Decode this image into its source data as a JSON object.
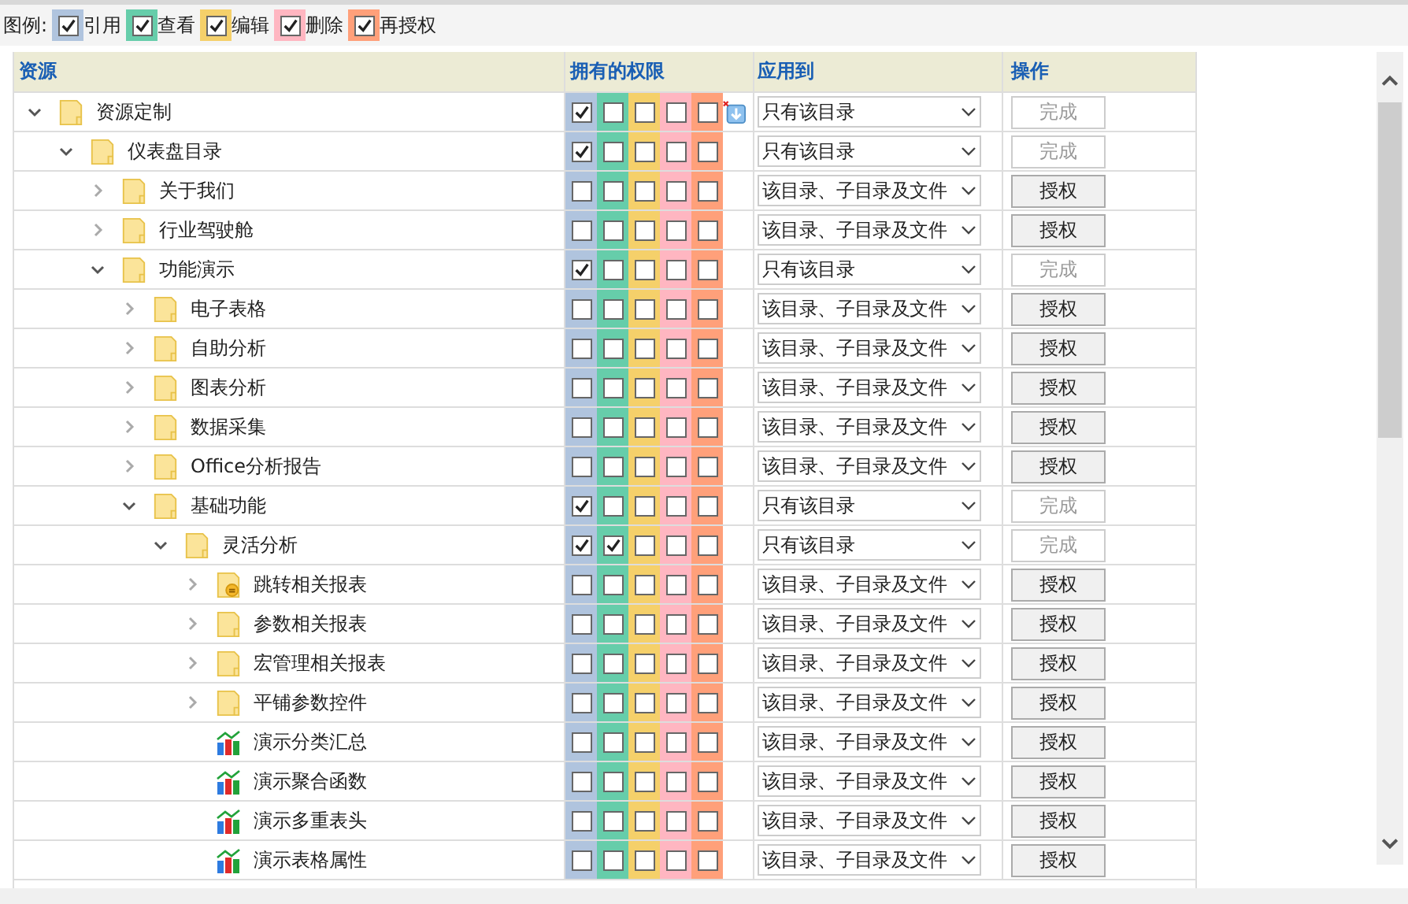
{
  "legend": {
    "title": "图例:",
    "items": [
      {
        "label": "引用",
        "checked": true,
        "color": "#b0c4de"
      },
      {
        "label": "查看",
        "checked": true,
        "color": "#66cdaa"
      },
      {
        "label": "编辑",
        "checked": true,
        "color": "#f5d06a"
      },
      {
        "label": "删除",
        "checked": true,
        "color": "#ffb6c1"
      },
      {
        "label": "再授权",
        "checked": true,
        "color": "#ffa07a"
      }
    ]
  },
  "table": {
    "columns": [
      "资源",
      "拥有的权限",
      "应用到",
      "操作"
    ],
    "tree": [
      {
        "name": "资源定制",
        "kind": "folder",
        "expanded": true,
        "perms": [
          true,
          false,
          false,
          false,
          false
        ],
        "apply_to": "只有该目录",
        "action": "完成",
        "disabled": true,
        "children": [
          {
            "name": "仪表盘目录",
            "kind": "folder",
            "expanded": true,
            "perms": [
              true,
              false,
              false,
              false,
              false
            ],
            "apply_to": "只有该目录",
            "action": "完成",
            "disabled": true,
            "children": [
              {
                "name": "关于我们",
                "kind": "folder",
                "expanded": false,
                "perms": [
                  false,
                  false,
                  false,
                  false,
                  false
                ],
                "apply_to": "该目录、子目录及文件",
                "action": "授权",
                "disabled": false
              },
              {
                "name": "行业驾驶舱",
                "kind": "folder",
                "expanded": false,
                "perms": [
                  false,
                  false,
                  false,
                  false,
                  false
                ],
                "apply_to": "该目录、子目录及文件",
                "action": "授权",
                "disabled": false
              },
              {
                "name": "功能演示",
                "kind": "folder",
                "expanded": true,
                "perms": [
                  true,
                  false,
                  false,
                  false,
                  false
                ],
                "apply_to": "只有该目录",
                "action": "完成",
                "disabled": true,
                "children": [
                  {
                    "name": "电子表格",
                    "kind": "folder",
                    "expanded": false,
                    "perms": [
                      false,
                      false,
                      false,
                      false,
                      false
                    ],
                    "apply_to": "该目录、子目录及文件",
                    "action": "授权",
                    "disabled": false
                  },
                  {
                    "name": "自助分析",
                    "kind": "folder",
                    "expanded": false,
                    "perms": [
                      false,
                      false,
                      false,
                      false,
                      false
                    ],
                    "apply_to": "该目录、子目录及文件",
                    "action": "授权",
                    "disabled": false
                  },
                  {
                    "name": "图表分析",
                    "kind": "folder",
                    "expanded": false,
                    "perms": [
                      false,
                      false,
                      false,
                      false,
                      false
                    ],
                    "apply_to": "该目录、子目录及文件",
                    "action": "授权",
                    "disabled": false
                  },
                  {
                    "name": "数据采集",
                    "kind": "folder",
                    "expanded": false,
                    "perms": [
                      false,
                      false,
                      false,
                      false,
                      false
                    ],
                    "apply_to": "该目录、子目录及文件",
                    "action": "授权",
                    "disabled": false
                  },
                  {
                    "name": "Office分析报告",
                    "kind": "folder",
                    "expanded": false,
                    "perms": [
                      false,
                      false,
                      false,
                      false,
                      false
                    ],
                    "apply_to": "该目录、子目录及文件",
                    "action": "授权",
                    "disabled": false
                  },
                  {
                    "name": "基础功能",
                    "kind": "folder",
                    "expanded": true,
                    "perms": [
                      true,
                      false,
                      false,
                      false,
                      false
                    ],
                    "apply_to": "只有该目录",
                    "action": "完成",
                    "disabled": true,
                    "children": [
                      {
                        "name": "灵活分析",
                        "kind": "folder",
                        "expanded": true,
                        "perms": [
                          true,
                          true,
                          false,
                          false,
                          false
                        ],
                        "apply_to": "只有该目录",
                        "action": "完成",
                        "disabled": true,
                        "children": [
                          {
                            "name": "跳转相关报表",
                            "kind": "linked-folder",
                            "expanded": false,
                            "perms": [
                              false,
                              false,
                              false,
                              false,
                              false
                            ],
                            "apply_to": "该目录、子目录及文件",
                            "action": "授权",
                            "disabled": false
                          },
                          {
                            "name": "参数相关报表",
                            "kind": "folder",
                            "expanded": false,
                            "perms": [
                              false,
                              false,
                              false,
                              false,
                              false
                            ],
                            "apply_to": "该目录、子目录及文件",
                            "action": "授权",
                            "disabled": false
                          },
                          {
                            "name": "宏管理相关报表",
                            "kind": "folder",
                            "expanded": false,
                            "perms": [
                              false,
                              false,
                              false,
                              false,
                              false
                            ],
                            "apply_to": "该目录、子目录及文件",
                            "action": "授权",
                            "disabled": false
                          },
                          {
                            "name": "平铺参数控件",
                            "kind": "folder",
                            "expanded": false,
                            "perms": [
                              false,
                              false,
                              false,
                              false,
                              false
                            ],
                            "apply_to": "该目录、子目录及文件",
                            "action": "授权",
                            "disabled": false
                          },
                          {
                            "name": "演示分类汇总",
                            "kind": "report",
                            "perms": [
                              false,
                              false,
                              false,
                              false,
                              false
                            ],
                            "apply_to": "该目录、子目录及文件",
                            "action": "授权",
                            "disabled": false
                          },
                          {
                            "name": "演示聚合函数",
                            "kind": "report",
                            "perms": [
                              false,
                              false,
                              false,
                              false,
                              false
                            ],
                            "apply_to": "该目录、子目录及文件",
                            "action": "授权",
                            "disabled": false
                          },
                          {
                            "name": "演示多重表头",
                            "kind": "report",
                            "perms": [
                              false,
                              false,
                              false,
                              false,
                              false
                            ],
                            "apply_to": "该目录、子目录及文件",
                            "action": "授权",
                            "disabled": false
                          },
                          {
                            "name": "演示表格属性",
                            "kind": "report",
                            "perms": [
                              false,
                              false,
                              false,
                              false,
                              false
                            ],
                            "apply_to": "该目录、子目录及文件",
                            "action": "授权",
                            "disabled": false
                          }
                        ]
                      }
                    ]
                  }
                ]
              }
            ]
          }
        ]
      }
    ]
  }
}
